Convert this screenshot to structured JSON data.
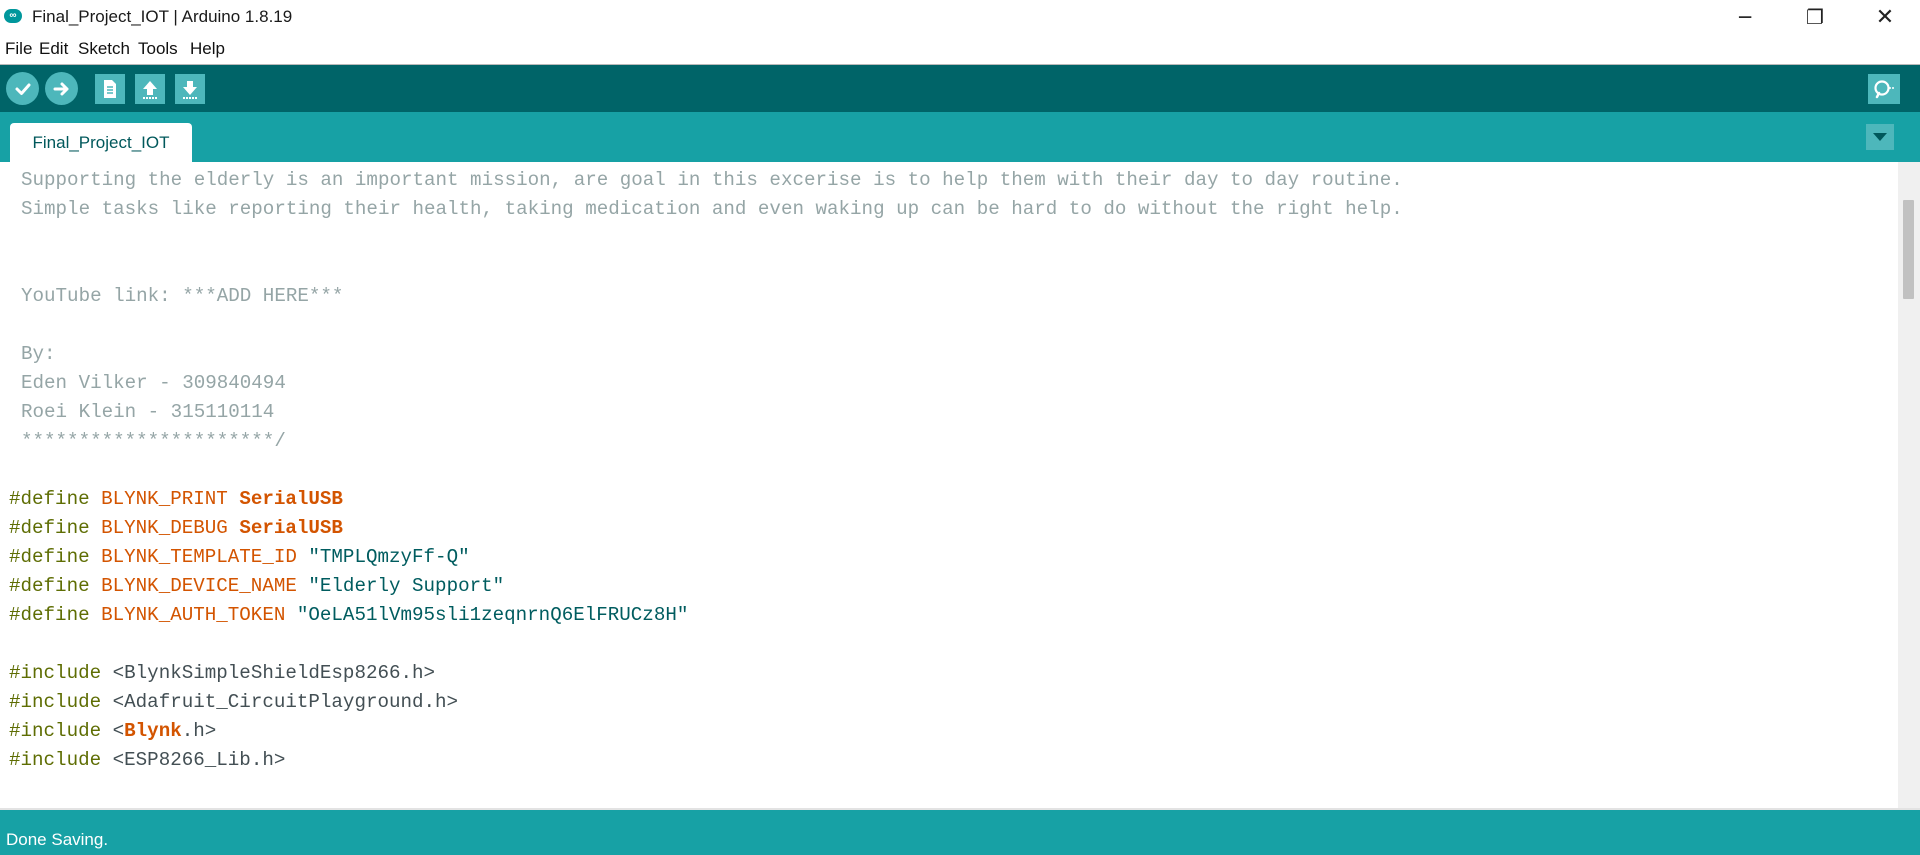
{
  "window": {
    "title": "Final_Project_IOT | Arduino 1.8.19",
    "logo_text": "∞",
    "minimize_glyph": "─",
    "maximize_glyph": "❐",
    "close_glyph": "✕"
  },
  "menu": [
    "File",
    "Edit",
    "Sketch",
    "Tools",
    "Help"
  ],
  "toolbar": {
    "buttons": [
      "verify-icon",
      "upload-icon",
      "new-icon",
      "open-icon",
      "save-icon"
    ],
    "serial_monitor": "serial-monitor-icon"
  },
  "tabs": [
    {
      "label": "Final_Project_IOT"
    }
  ],
  "editor": {
    "comment_lines": [
      "Supporting the elderly is an important mission, are goal in this excerise is to help them with their day to day routine.",
      "Simple tasks like reporting their health, taking medication and even waking up can be hard to do without the right help.",
      "YouTube link: ***ADD HERE***",
      "By:",
      "Eden Vilker - 309840494",
      "Roei Klein - 315110114",
      "**********************/"
    ],
    "defines": [
      {
        "kw": "#define",
        "name": "BLYNK_PRINT",
        "value": "SerialUSB"
      },
      {
        "kw": "#define",
        "name": "BLYNK_DEBUG",
        "value": "SerialUSB"
      },
      {
        "kw": "#define",
        "name": "BLYNK_TEMPLATE_ID",
        "value": "\"TMPLQmzyFf-Q\""
      },
      {
        "kw": "#define",
        "name": "BLYNK_DEVICE_NAME",
        "value": "\"Elderly Support\""
      },
      {
        "kw": "#define",
        "name": "BLYNK_AUTH_TOKEN",
        "value": "\"OeLA51lVm95sli1zeqnrnQ6ElFRUCz8H\""
      }
    ],
    "includes": [
      {
        "kw": "#include",
        "pre": "<BlynkSimpleShieldEsp8266.h>",
        "mid": "",
        "post": ""
      },
      {
        "kw": "#include",
        "pre": "<Adafruit_CircuitPlayground.h>",
        "mid": "",
        "post": ""
      },
      {
        "kw": "#include",
        "pre": "<",
        "mid": "Blynk",
        "post": ".h>"
      },
      {
        "kw": "#include",
        "pre": "<ESP8266_Lib.h>",
        "mid": "",
        "post": ""
      }
    ]
  },
  "status": {
    "message": "Done Saving."
  },
  "colors": {
    "toolbar": "#006468",
    "tabbar": "#17a1a5",
    "button": "#4db7bb",
    "comment": "#95a5a6",
    "directive": "#5e6d03",
    "constant": "#d35400",
    "string": "#005c5f"
  }
}
